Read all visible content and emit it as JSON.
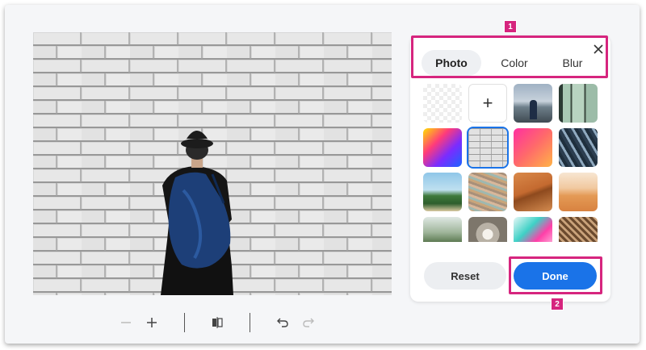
{
  "editor": {
    "tabs": [
      {
        "label": "Photo",
        "active": true
      },
      {
        "label": "Color",
        "active": false
      },
      {
        "label": "Blur",
        "active": false
      }
    ],
    "reset_label": "Reset",
    "done_label": "Done",
    "plus_label": "+",
    "selected_tile": "white brick wall",
    "tiles": [
      "transparent",
      "upload",
      "person at viewpoint",
      "window interior",
      "rainbow gradient",
      "white brick wall",
      "pink orange gradient",
      "glass building",
      "palm trees beach",
      "colorful wall",
      "desert dunes",
      "orange desert",
      "forest bridge",
      "corridor arches",
      "teal pink abstract",
      "wooden roof"
    ]
  },
  "annotations": {
    "badge_1": "1",
    "badge_2": "2",
    "accent_color": "#d6257e"
  },
  "toolbar": {
    "icons": [
      "zoom-out-icon",
      "zoom-in-icon",
      "flip-icon",
      "undo-icon",
      "redo-icon"
    ]
  },
  "colors": {
    "primary": "#1a73e8",
    "highlight": "#d6257e"
  }
}
